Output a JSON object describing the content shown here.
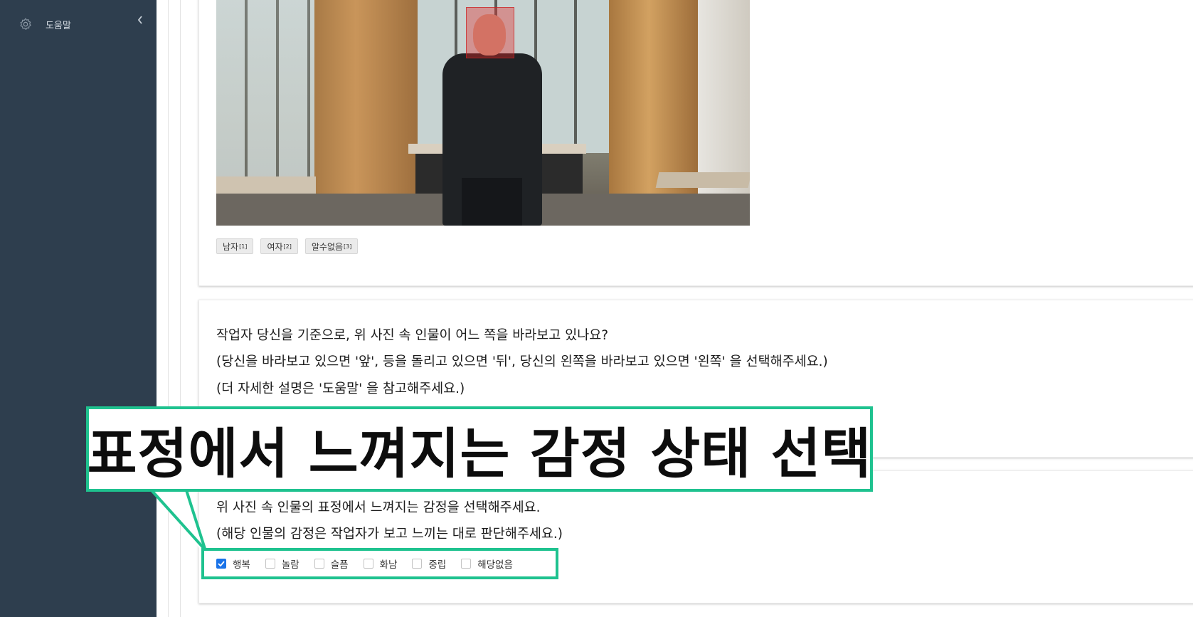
{
  "sidebar": {
    "help_label": "도움말",
    "help_icon": "gear-icon",
    "collapse_icon": "chevron-left-icon"
  },
  "card1": {
    "photo_icon": "person-photo",
    "tags": [
      {
        "label": "남자",
        "sup": "[1]"
      },
      {
        "label": "여자",
        "sup": "[2]"
      },
      {
        "label": "알수없음",
        "sup": "[3]"
      }
    ]
  },
  "card2": {
    "line1": "작업자 당신을 기준으로, 위 사진 속 인물이 어느 쪽을 바라보고 있나요?",
    "line2": "(당신을 바라보고 있으면 '앞', 등을 돌리고 있으면 '뒤', 당신의 왼쪽을 바라보고 있으면 '왼쪽' 을 선택해주세요.)",
    "line3": "(더 자세한 설명은 '도움말' 을 참고해주세요.)"
  },
  "card3": {
    "line1": "위 사진 속 인물의 표정에서 느껴지는 감정을 선택해주세요.",
    "line2": "(해당 인물의 감정은 작업자가 보고 느끼는 대로 판단해주세요.)",
    "options": [
      {
        "label": "행복",
        "checked": true
      },
      {
        "label": "놀람",
        "checked": false
      },
      {
        "label": "슬픔",
        "checked": false
      },
      {
        "label": "화남",
        "checked": false
      },
      {
        "label": "중립",
        "checked": false
      },
      {
        "label": "해당없음",
        "checked": false
      }
    ]
  },
  "annotation": {
    "callout_text": "표정에서 느껴지는 감정 상태 선택",
    "accent_color": "#1fc28f"
  },
  "colors": {
    "sidebar_bg": "#2e3e4e",
    "checkbox_checked": "#1a73e8"
  }
}
